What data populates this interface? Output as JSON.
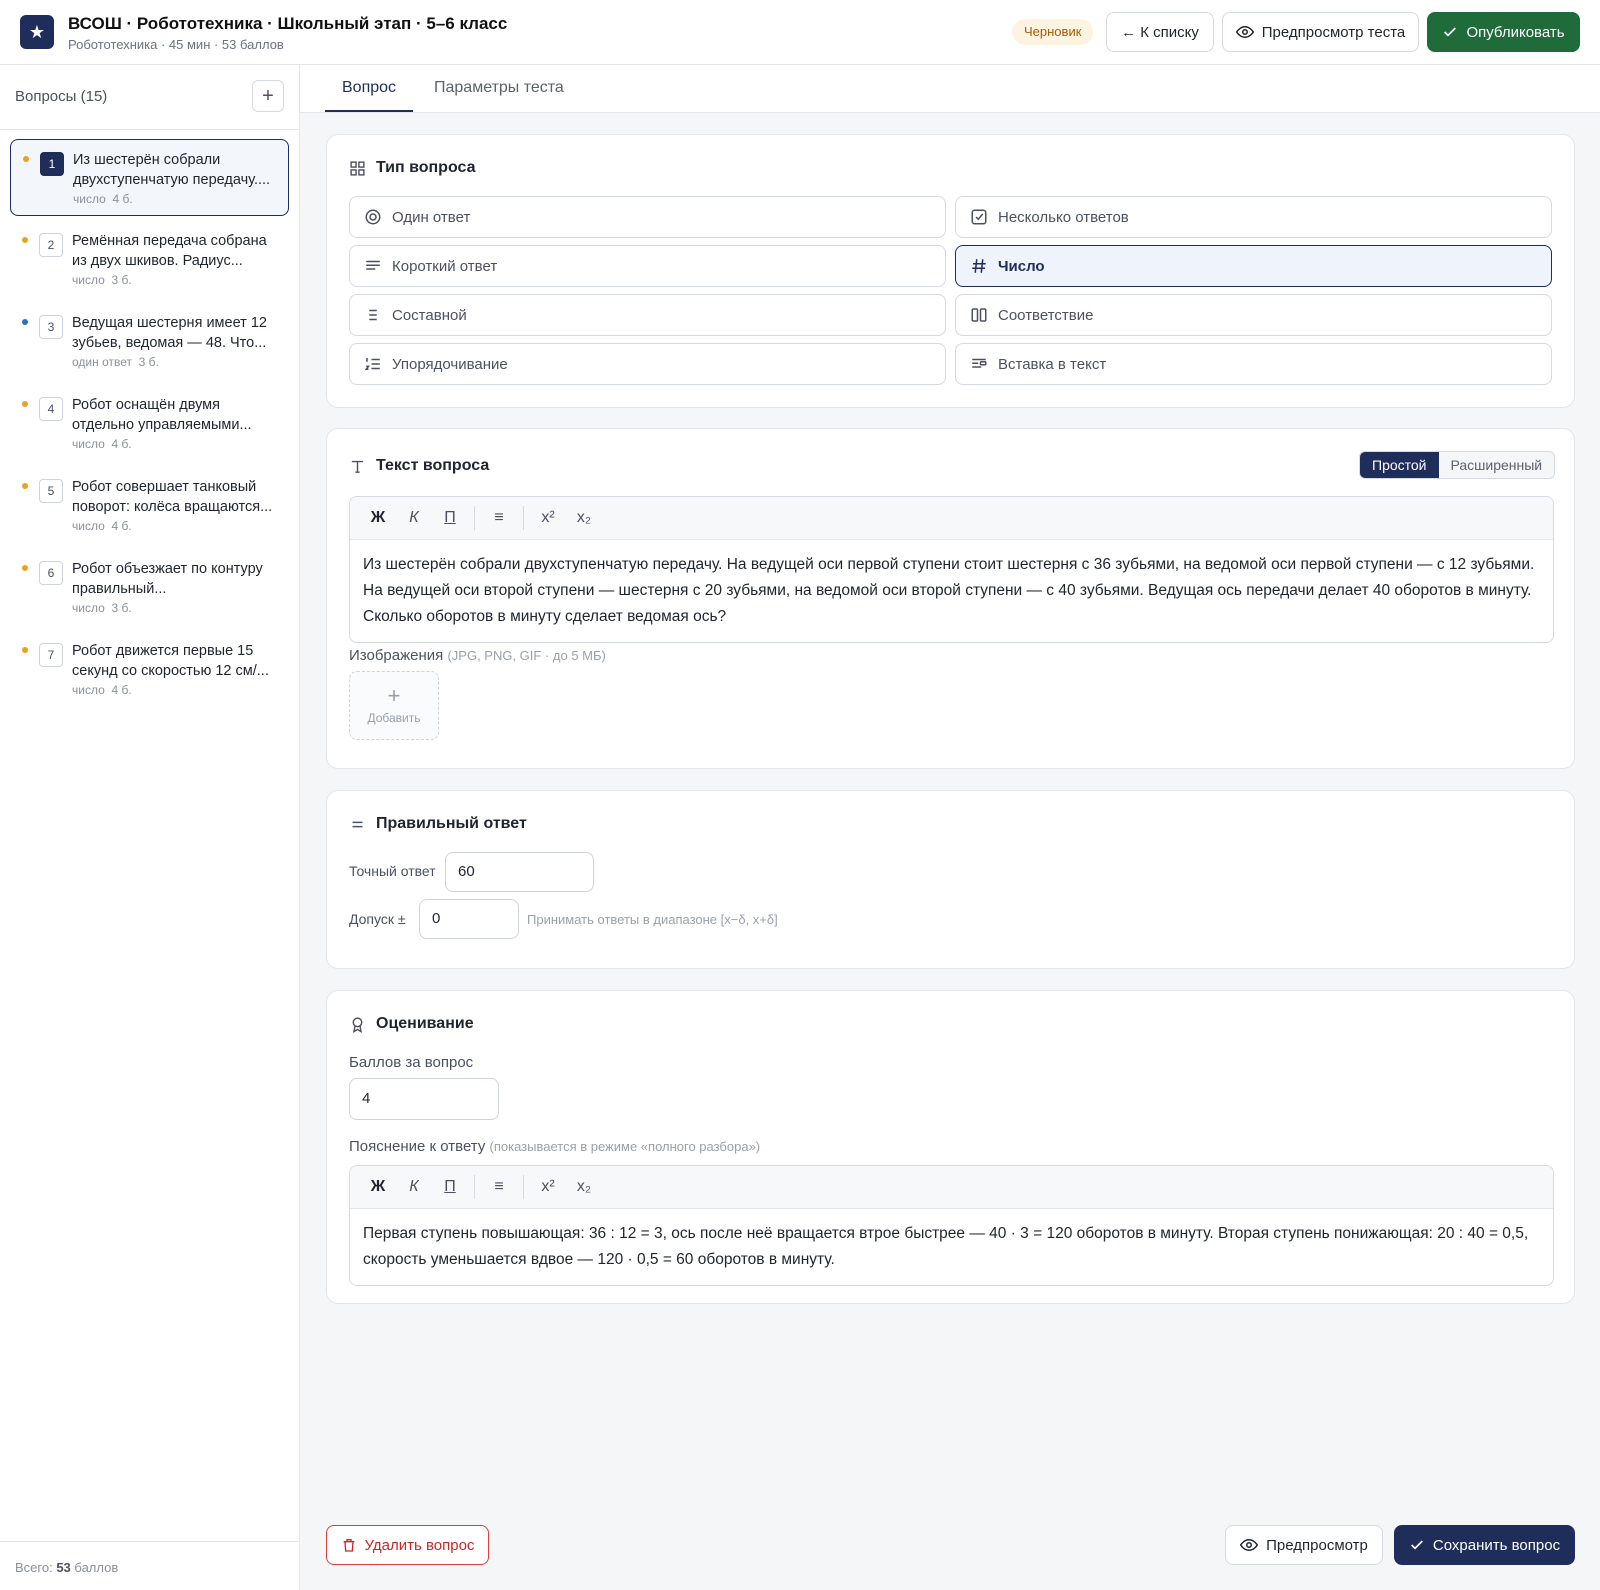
{
  "header": {
    "logo_glyph": "★",
    "title": "ВСОШ · Робототехника · Школьный этап · 5–6 класс",
    "subtitle": "Робототехника · 45 мин · 53 баллов",
    "status_badge": "Черновик",
    "back_label": "← К списку",
    "preview_label": "Предпросмотр теста",
    "publish_label": "Опубликовать"
  },
  "sidebar": {
    "title": "Вопросы (15)",
    "add_label": "+",
    "items": [
      {
        "num": "1",
        "text": "Из шестерён собрали двухступенчатую передачу....",
        "type": "число",
        "points": "4 б.",
        "dot": "#e9a21b"
      },
      {
        "num": "2",
        "text": "Ремённая передача собрана из двух шкивов. Радиус...",
        "type": "число",
        "points": "3 б.",
        "dot": "#e9a21b"
      },
      {
        "num": "3",
        "text": "Ведущая шестерня имеет 12 зубьев, ведомая — 48. Что...",
        "type": "один ответ",
        "points": "3 б.",
        "dot": "#2f6fc2"
      },
      {
        "num": "4",
        "text": "Робот оснащён двумя отдельно управляемыми...",
        "type": "число",
        "points": "4 б.",
        "dot": "#e9a21b"
      },
      {
        "num": "5",
        "text": "Робот совершает танковый поворот: колёса вращаются...",
        "type": "число",
        "points": "4 б.",
        "dot": "#e9a21b"
      },
      {
        "num": "6",
        "text": "Робот объезжает по контуру правильный...",
        "type": "число",
        "points": "3 б.",
        "dot": "#e9a21b"
      },
      {
        "num": "7",
        "text": "Робот движется первые 15 секунд со скоростью 12 см/...",
        "type": "число",
        "points": "4 б.",
        "dot": "#e9a21b"
      }
    ],
    "total_prefix": "Всего:",
    "total_value": "53",
    "total_suffix": "баллов"
  },
  "tabs": [
    "Вопрос",
    "Параметры теста"
  ],
  "question_type": {
    "title": "Тип вопроса",
    "options": [
      {
        "label": "Один ответ",
        "icon": "radio-icon"
      },
      {
        "label": "Несколько ответов",
        "icon": "checkbox-icon"
      },
      {
        "label": "Короткий ответ",
        "icon": "lines-icon"
      },
      {
        "label": "Число",
        "icon": "hash-icon",
        "selected": true
      },
      {
        "label": "Составной",
        "icon": "list-icon"
      },
      {
        "label": "Соответствие",
        "icon": "columns-icon"
      },
      {
        "label": "Упорядочивание",
        "icon": "ordered-list-icon"
      },
      {
        "label": "Вставка в текст",
        "icon": "text-insert-icon"
      }
    ]
  },
  "question_text": {
    "title": "Текст вопроса",
    "mode_simple": "Простой",
    "mode_advanced": "Расширенный",
    "toolbar": {
      "bold": "Ж",
      "italic": "К",
      "underline": "П",
      "list": "≡",
      "sup": "x²",
      "sub": "x₂"
    },
    "body": "Из шестерён собрали двухступенчатую передачу. На ведущей оси первой ступени стоит шестерня с 36 зубьями, на ведомой оси первой ступени — с 12 зубьями. На ведущей оси второй ступени — шестерня с 20 зубьями, на ведомой оси второй ступени — с 40 зубьями. Ведущая ось передачи делает 40 оборотов в минуту. Сколько оборотов в минуту сделает ведомая ось?",
    "images_label": "Изображения",
    "images_hint": "(JPG, PNG, GIF · до 5 МБ)",
    "add_image_plus": "+",
    "add_image_label": "Добавить"
  },
  "correct_answer": {
    "title": "Правильный ответ",
    "exact_label": "Точный ответ",
    "exact_value": "60",
    "tolerance_label": "Допуск ±",
    "tolerance_value": "0",
    "tolerance_hint": "Принимать ответы в диапазоне [x−δ, x+δ]"
  },
  "grading": {
    "title": "Оценивание",
    "points_label": "Баллов за вопрос",
    "points_value": "4",
    "explanation_label": "Пояснение к ответу",
    "explanation_hint": "(показывается в режиме «полного разбора»)",
    "explanation_body": "Первая ступень повышающая: 36 : 12 = 3, ось после неё вращается втрое быстрее — 40 · 3 = 120 оборотов в минуту. Вторая ступень понижающая: 20 : 40 = 0,5, скорость уменьшается вдвое — 120 · 0,5 = 60 оборотов в минуту."
  },
  "footer": {
    "delete_label": "Удалить вопрос",
    "preview_label": "Предпросмотр",
    "save_label": "Сохранить вопрос"
  },
  "colors": {
    "brand": "#1e2d5a",
    "publish": "#1f6b3a",
    "danger": "#c62828",
    "draft_bg": "#fdf3e1"
  }
}
